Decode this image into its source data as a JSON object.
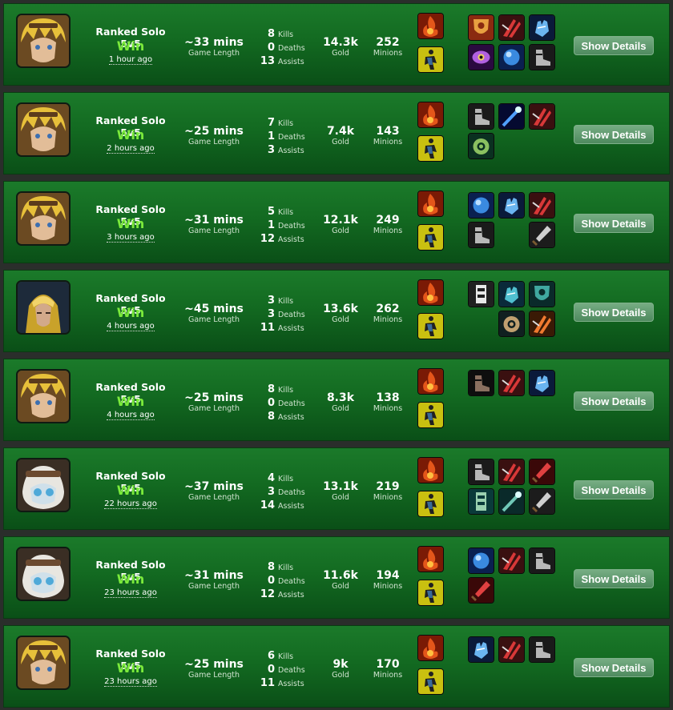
{
  "details_label": "Show Details",
  "labels": {
    "game_length": "Game Length",
    "kills": "Kills",
    "deaths": "Deaths",
    "assists": "Assists",
    "gold": "Gold",
    "minions": "Minions"
  },
  "matches": [
    {
      "champion": "blond-champion-portrait",
      "queue": "Ranked Solo 5v5",
      "result": "Win",
      "time_ago": "1 hour ago",
      "length": "~33 mins",
      "kills": "8",
      "deaths": "0",
      "assists": "13",
      "gold": "14.3k",
      "minions": "252",
      "spells": [
        "ignite-icon",
        "ghost-icon"
      ],
      "items": [
        "sword-shield-icon",
        "red-claw-icon",
        "blue-gauntlet-icon",
        "purple-eye-icon",
        "blue-orb-icon",
        "grey-boots-icon"
      ]
    },
    {
      "champion": "blond-champion-portrait",
      "queue": "Ranked Solo 5v5",
      "result": "Win",
      "time_ago": "2 hours ago",
      "length": "~25 mins",
      "kills": "7",
      "deaths": "1",
      "assists": "3",
      "gold": "7.4k",
      "minions": "143",
      "spells": [
        "ignite-icon",
        "ghost-icon"
      ],
      "items": [
        "grey-boots-icon",
        "blue-wand-icon",
        "red-claw-icon",
        "green-amulet-icon"
      ]
    },
    {
      "champion": "blond-champion-portrait",
      "queue": "Ranked Solo 5v5",
      "result": "Win",
      "time_ago": "3 hours ago",
      "length": "~31 mins",
      "kills": "5",
      "deaths": "1",
      "assists": "12",
      "gold": "12.1k",
      "minions": "249",
      "spells": [
        "ignite-icon",
        "ghost-icon"
      ],
      "items": [
        "blue-orb-icon",
        "blue-gauntlet-icon",
        "red-claw-icon",
        "grey-boots-icon",
        "",
        "dagger-icon"
      ]
    },
    {
      "champion": "golden-helmet-champion-portrait",
      "queue": "Ranked Solo 5v5",
      "result": "Win",
      "time_ago": "4 hours ago",
      "length": "~45 mins",
      "kills": "3",
      "deaths": "3",
      "assists": "11",
      "gold": "13.6k",
      "minions": "262",
      "spells": [
        "ignite-icon",
        "ghost-icon"
      ],
      "items": [
        "white-totem-icon",
        "teal-blade-icon",
        "teal-hammer-icon",
        "",
        "teal-swirl-icon",
        "orange-claw-icon"
      ]
    },
    {
      "champion": "blond-champion-portrait",
      "queue": "Ranked Solo 5v5",
      "result": "Win",
      "time_ago": "4 hours ago",
      "length": "~25 mins",
      "kills": "8",
      "deaths": "0",
      "assists": "8",
      "gold": "8.3k",
      "minions": "138",
      "spells": [
        "ignite-icon",
        "ghost-icon"
      ],
      "items": [
        "dark-boots-icon",
        "red-claw-icon",
        "blue-gauntlet-icon"
      ]
    },
    {
      "champion": "white-haired-champion-portrait",
      "queue": "Ranked Solo 5v5",
      "result": "Win",
      "time_ago": "22 hours ago",
      "length": "~37 mins",
      "kills": "4",
      "deaths": "3",
      "assists": "14",
      "gold": "13.1k",
      "minions": "219",
      "spells": [
        "ignite-icon",
        "ghost-icon"
      ],
      "items": [
        "grey-boots-icon",
        "red-claw-icon",
        "red-blade-icon",
        "green-armor-icon",
        "teal-scythe-icon",
        "dagger-icon"
      ]
    },
    {
      "champion": "white-haired-champion-portrait",
      "queue": "Ranked Solo 5v5",
      "result": "Win",
      "time_ago": "23 hours ago",
      "length": "~31 mins",
      "kills": "8",
      "deaths": "0",
      "assists": "12",
      "gold": "11.6k",
      "minions": "194",
      "spells": [
        "ignite-icon",
        "ghost-icon"
      ],
      "items": [
        "blue-orb-icon",
        "red-claw-icon",
        "grey-boots-icon",
        "red-blade-icon"
      ]
    },
    {
      "champion": "blond-champion-portrait",
      "queue": "Ranked Solo 5v5",
      "result": "Win",
      "time_ago": "23 hours ago",
      "length": "~25 mins",
      "kills": "6",
      "deaths": "0",
      "assists": "11",
      "gold": "9k",
      "minions": "170",
      "spells": [
        "ignite-icon",
        "ghost-icon"
      ],
      "items": [
        "blue-gauntlet-icon",
        "red-claw-icon",
        "grey-boots-icon"
      ]
    }
  ]
}
